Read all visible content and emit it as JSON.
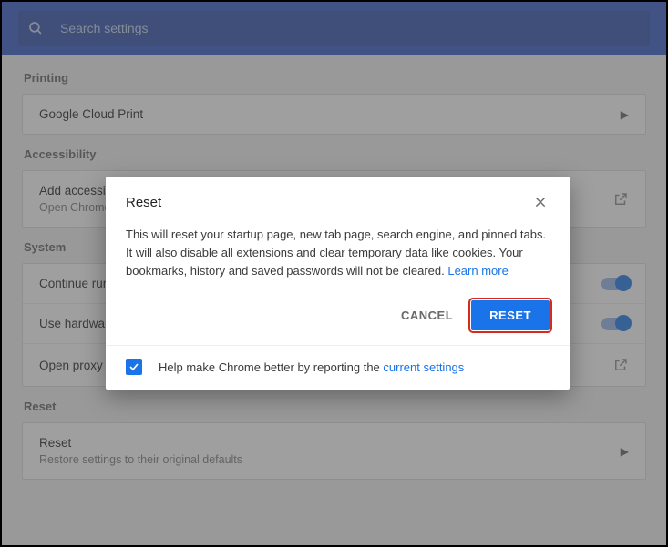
{
  "search": {
    "placeholder": "Search settings"
  },
  "sections": {
    "printing": {
      "label": "Printing",
      "item_label": "Google Cloud Print"
    },
    "accessibility": {
      "label": "Accessibility",
      "item_label": "Add accessibility features",
      "item_sub": "Open Chrome Web Store"
    },
    "system": {
      "label": "System",
      "row1": "Continue running background apps when Google Chrome is closed",
      "row2": "Use hardware acceleration when available",
      "row3": "Open proxy settings"
    },
    "reset": {
      "label": "Reset",
      "item_label": "Reset",
      "item_sub": "Restore settings to their original defaults"
    }
  },
  "modal": {
    "title": "Reset",
    "body_text": "This will reset your startup page, new tab page, search engine, and pinned tabs. It will also disable all extensions and clear temporary data like cookies. Your bookmarks, history and saved passwords will not be cleared. ",
    "learn_more": "Learn more",
    "cancel": "CANCEL",
    "confirm": "RESET",
    "checkbox_checked": true,
    "footer_text": "Help make Chrome better by reporting the ",
    "footer_link": "current settings"
  }
}
